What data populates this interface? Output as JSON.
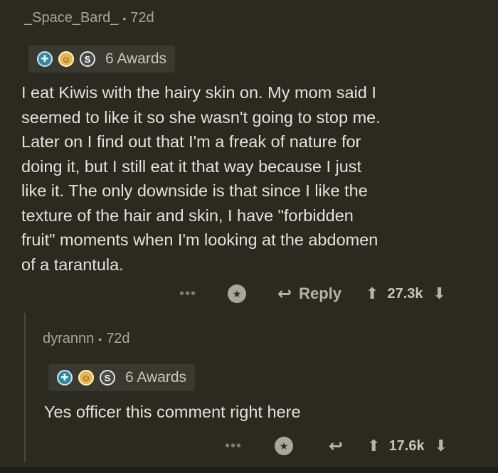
{
  "comment1": {
    "author": "_Space_Bard_",
    "age": "72d",
    "awards": [
      "helpful-award-icon",
      "wholesome-award-icon",
      "silver-award-icon"
    ],
    "awards_label": "6 Awards",
    "text": "I eat Kiwis with the hairy skin on. My mom said I\nseemed to like it so she wasn't going to stop me.\nLater on I find out that I'm a freak of nature for\ndoing it, but I still eat it that way because I just\nlike it. The only downside is that since I like the\ntexture of the hair and skin, I have \"forbidden\nfruit\" moments when I'm looking at the  abdomen\nof a tarantula.",
    "more": "•••",
    "reply_label": "Reply",
    "score": "27.3k"
  },
  "comment2": {
    "author": "dyrannn",
    "age": "72d",
    "awards": [
      "helpful-award-icon",
      "wholesome-award-icon",
      "silver-award-icon"
    ],
    "awards_label": "6 Awards",
    "text": "Yes officer this comment right here",
    "more": "•••",
    "score": "17.6k"
  },
  "colors": {
    "background": "#2b2a21",
    "text": "#e4e1da",
    "muted": "#a9a69d"
  }
}
